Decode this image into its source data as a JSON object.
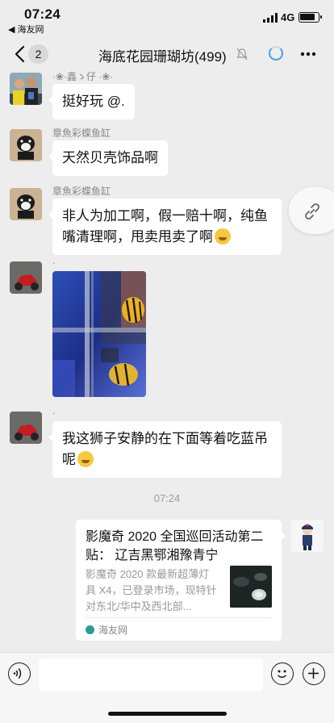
{
  "status_bar": {
    "time": "07:24",
    "back_app": "◀ 海友网",
    "network": "4G"
  },
  "nav": {
    "back_count": "2",
    "title": "海底花园珊瑚坊(499)"
  },
  "messages": [
    {
      "sender": "·❀·鑫ゝ仔 ·❀·",
      "text": "挺好玩 @."
    },
    {
      "sender": "章魚彩蝶鱼缸",
      "text": "天然贝壳饰品啊"
    },
    {
      "sender": "章魚彩蝶鱼缸",
      "text": "非人为加工啊，假一赔十啊，纯鱼嘴清理啊，甩卖甩卖了啊"
    },
    {
      "sender": ".",
      "image": "aquarium-photo"
    },
    {
      "sender": ".",
      "text": "我这狮子安静的在下面等着吃蓝吊呢"
    }
  ],
  "timestamp": "07:24",
  "card": {
    "title": "影魔奇 2020 全国巡回活动第二贴： 辽吉黑鄂湘豫青宁",
    "description": "影魔奇 2020 款最新超薄灯具 X4，已登录市场，现特针对东北/华中及西北部...",
    "source": "海友网"
  },
  "icons": [
    "back-chevron-icon",
    "mute-icon",
    "loading-icon",
    "more-icon",
    "link-icon",
    "voice-icon",
    "emoji-icon",
    "plus-icon"
  ]
}
